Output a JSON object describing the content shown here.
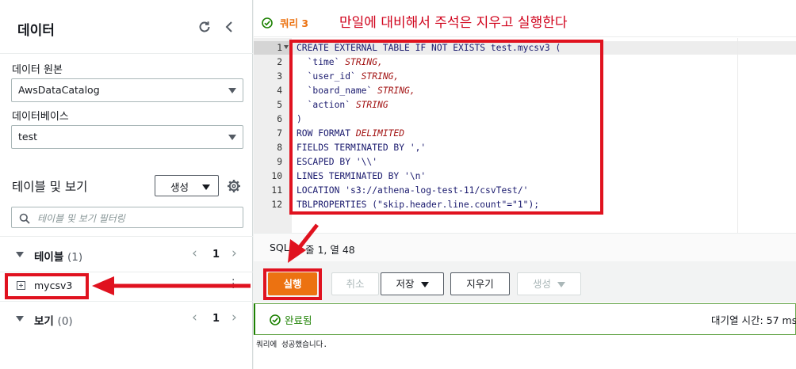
{
  "left_panel": {
    "title": "데이터",
    "data_source_label": "데이터 원본",
    "data_source_value": "AwsDataCatalog",
    "database_label": "데이터베이스",
    "database_value": "test",
    "tables_views_title": "테이블 및 보기",
    "create_button": "생성",
    "filter_placeholder": "테이블 및 보기 필터링",
    "tables_group": {
      "title": "테이블",
      "count": "(1)",
      "page": "1"
    },
    "table_items": [
      "mycsv3"
    ],
    "views_group": {
      "title": "보기",
      "count": "(0)",
      "page": "1"
    }
  },
  "query_tab": {
    "label": "쿼리 3"
  },
  "annotation": "만일에 대비해서 주석은 지우고 실행한다",
  "editor": {
    "lines": [
      {
        "n": "1",
        "text": "CREATE EXTERNAL TABLE IF NOT EXISTS test.mycsv3 ("
      },
      {
        "n": "2",
        "text": "  `time`",
        "type": " STRING,",
        "has_type": true
      },
      {
        "n": "3",
        "text": "  `user_id`",
        "type": " STRING,",
        "has_type": true
      },
      {
        "n": "4",
        "text": "  `board_name`",
        "type": " STRING,",
        "has_type": true
      },
      {
        "n": "5",
        "text": "  `action`",
        "type": " STRING",
        "has_type": true
      },
      {
        "n": "6",
        "text": ")"
      },
      {
        "n": "7",
        "text": "ROW FORMAT",
        "type": " DELIMITED",
        "has_type": true
      },
      {
        "n": "8",
        "text": "FIELDS TERMINATED BY ','"
      },
      {
        "n": "9",
        "text": "ESCAPED BY '\\\\'"
      },
      {
        "n": "10",
        "text": "LINES TERMINATED BY '\\n'"
      },
      {
        "n": "11",
        "text": "LOCATION 's3://athena-log-test-11/csvTest/'"
      },
      {
        "n": "12",
        "text": "TBLPROPERTIES (\"skip.header.line.count\"=\"1\");"
      }
    ]
  },
  "status_bar": {
    "language": "SQL",
    "position": "줄 1, 열 48"
  },
  "buttons": {
    "run": "실행",
    "cancel": "취소",
    "save": "저장",
    "clear": "지우기",
    "create": "생성"
  },
  "result": {
    "status": "완료됨",
    "queue_time": "대기열 시간:  57 ms",
    "message": "쿼리에 성공했습니다."
  },
  "colors": {
    "accent_orange": "#ec7211",
    "success_green": "#1d8102",
    "annotation_red": "#e0121f"
  }
}
